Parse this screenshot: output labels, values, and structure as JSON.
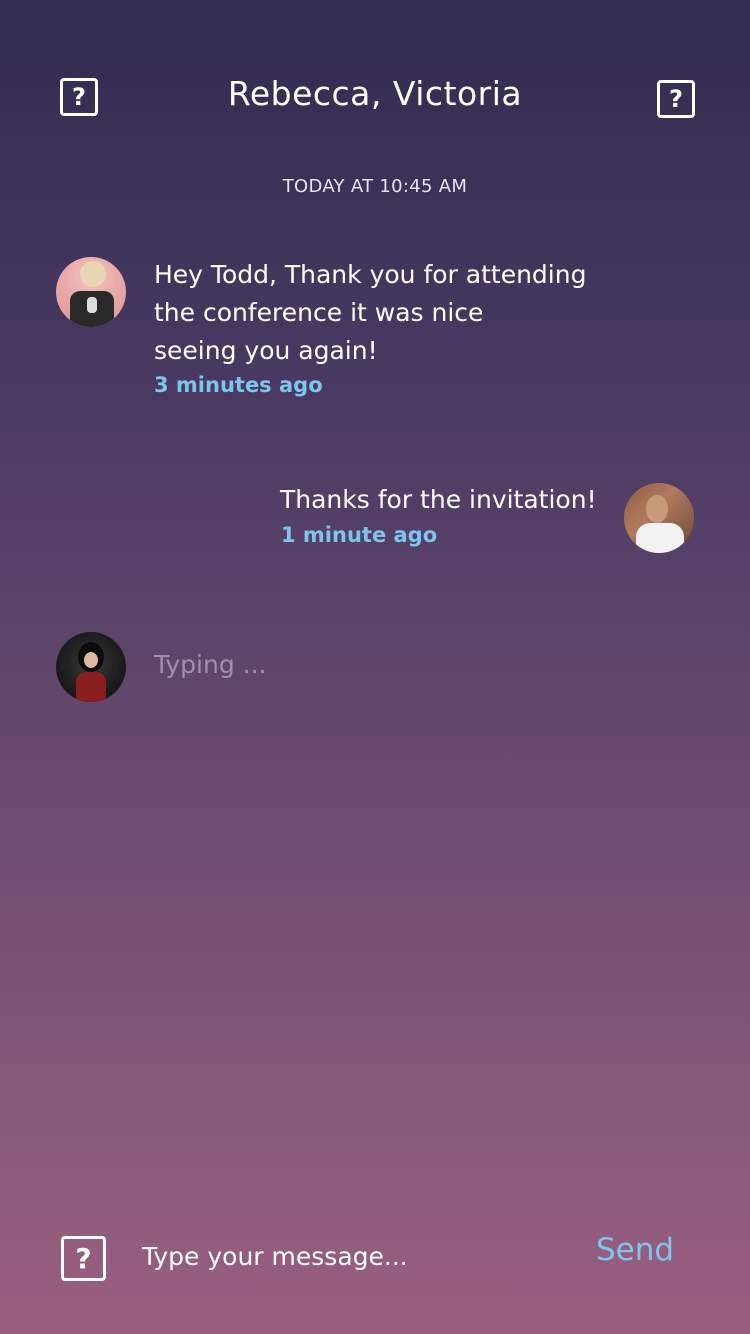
{
  "header": {
    "title": "Rebecca, Victoria",
    "left_icon": "question-mark-icon",
    "right_icon": "question-mark-icon"
  },
  "conversation": {
    "date_separator": "TODAY AT 10:45 AM",
    "messages": [
      {
        "text": "Hey Todd, Thank you for attending\nthe conference it was nice\nseeing you again!",
        "time": "3 minutes ago",
        "side": "left"
      },
      {
        "text": "Thanks for the invitation!",
        "time": "1 minute ago",
        "side": "right"
      }
    ],
    "typing_indicator": "Typing ..."
  },
  "composer": {
    "icon": "question-mark-icon",
    "placeholder": "Type your message...",
    "value": "",
    "send_label": "Send"
  },
  "colors": {
    "accent": "#7ec4ec",
    "text": "#ffffff",
    "typing": "#9f8fa9",
    "gradient_top": "#312c4f",
    "gradient_bottom": "#9a5f7e"
  }
}
